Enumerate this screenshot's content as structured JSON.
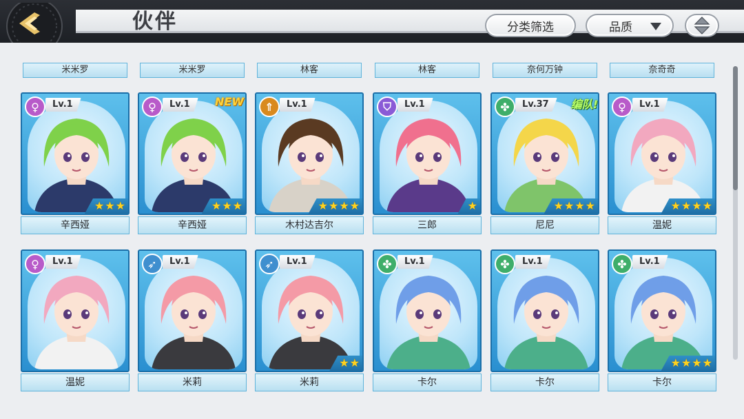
{
  "header": {
    "title": "伙伴",
    "filter_label": "分类筛选",
    "quality_label": "品质"
  },
  "top_row_names": [
    "米米罗",
    "米米罗",
    "林客",
    "林客",
    "奈何万钟",
    "奈奇奇"
  ],
  "partners": [
    {
      "name": "辛西娅",
      "level": "Lv.1",
      "stars": 3,
      "class": "psychic",
      "badge": "",
      "hair": "#7fd14a",
      "outfit": "#2c3a6a"
    },
    {
      "name": "辛西娅",
      "level": "Lv.1",
      "stars": 3,
      "class": "psychic",
      "badge": "NEW",
      "hair": "#7fd14a",
      "outfit": "#2c3a6a"
    },
    {
      "name": "木村达吉尔",
      "level": "Lv.1",
      "stars": 4,
      "class": "attack",
      "badge": "",
      "hair": "#5a3a22",
      "outfit": "#d8d2c8"
    },
    {
      "name": "三郎",
      "level": "Lv.1",
      "stars": 1,
      "class": "defense",
      "badge": "",
      "hair": "#f0708e",
      "outfit": "#5a3a8a"
    },
    {
      "name": "尼尼",
      "level": "Lv.37",
      "stars": 4,
      "class": "support",
      "badge": "编队!",
      "hair": "#f4d64a",
      "outfit": "#7fc46a"
    },
    {
      "name": "温妮",
      "level": "Lv.1",
      "stars": 4,
      "class": "psychic",
      "badge": "",
      "hair": "#f2a8bf",
      "outfit": "#f2f2f2"
    },
    {
      "name": "温妮",
      "level": "Lv.1",
      "stars": 0,
      "class": "psychic",
      "badge": "",
      "hair": "#f2a8bf",
      "outfit": "#f2f2f2"
    },
    {
      "name": "米莉",
      "level": "Lv.1",
      "stars": 0,
      "class": "ranged",
      "badge": "",
      "hair": "#f49aa6",
      "outfit": "#3a3a3e"
    },
    {
      "name": "米莉",
      "level": "Lv.1",
      "stars": 2,
      "class": "ranged",
      "badge": "",
      "hair": "#f49aa6",
      "outfit": "#3a3a3e"
    },
    {
      "name": "卡尔",
      "level": "Lv.1",
      "stars": 0,
      "class": "support",
      "badge": "",
      "hair": "#6f9ee8",
      "outfit": "#4caf8a"
    },
    {
      "name": "卡尔",
      "level": "Lv.1",
      "stars": 0,
      "class": "support",
      "badge": "",
      "hair": "#6f9ee8",
      "outfit": "#4caf8a"
    },
    {
      "name": "卡尔",
      "level": "Lv.1",
      "stars": 4,
      "class": "support",
      "badge": "",
      "hair": "#6f9ee8",
      "outfit": "#4caf8a"
    }
  ],
  "class_colors": {
    "psychic": "#b85bc9",
    "attack": "#d98a1e",
    "defense": "#8a5bd6",
    "support": "#3fae6a",
    "ranged": "#3f8fcf"
  }
}
